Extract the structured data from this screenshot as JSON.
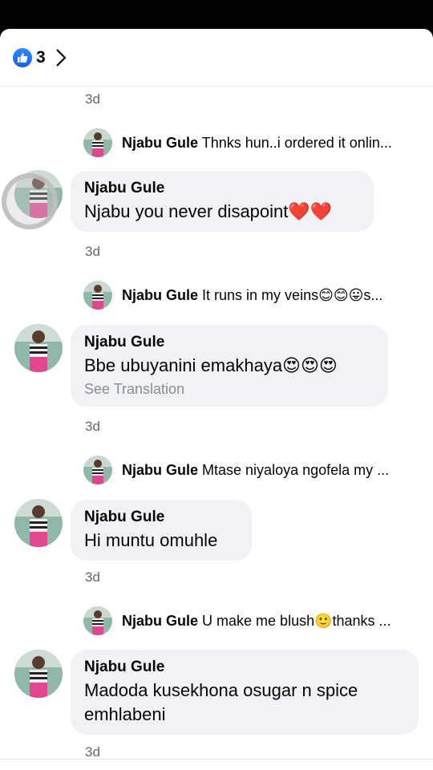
{
  "header": {
    "like_count": "3"
  },
  "timestamps": [
    "3d",
    "3d",
    "3d",
    "3d",
    "3d"
  ],
  "replies": [
    {
      "name": "Njabu Gule",
      "text": "Thnks hun..i ordered it onlin..."
    },
    {
      "name": "Njabu Gule",
      "text": "It runs in my veins😊😊😛s..."
    },
    {
      "name": "Njabu Gule",
      "text": "Mtase niyaloya ngofela my ..."
    },
    {
      "name": "Njabu Gule",
      "text": "U make me blush🙂thanks ..."
    }
  ],
  "comments": [
    {
      "name": "Njabu Gule",
      "text": "Njabu you never disapoint❤️❤️"
    },
    {
      "name": "Njabu Gule",
      "text": "Bbe ubuyanini emakhaya😍😍😍",
      "see_translation": "See Translation"
    },
    {
      "name": "Njabu Gule",
      "text": "Hi muntu omuhle"
    },
    {
      "name": "Njabu Gule",
      "text": "Madoda kusekhona osugar n spice emhlabeni"
    }
  ],
  "colors": {
    "like_blue": "#1877f2",
    "bubble_bg": "#f0f2f5",
    "meta_gray": "#65676b"
  },
  "icons": {
    "like": "thumbs-up-icon",
    "more": "chevron-right-icon"
  }
}
